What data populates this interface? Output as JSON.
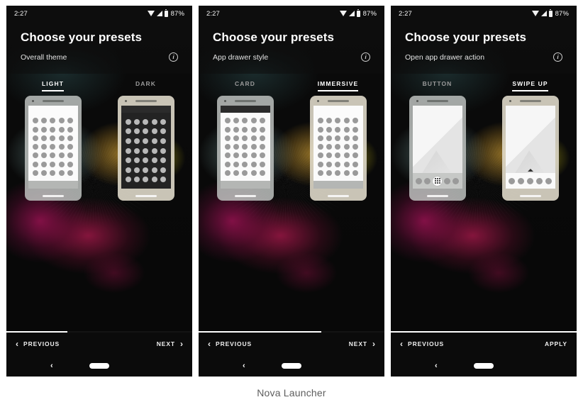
{
  "caption": "Nova Launcher",
  "status_bar": {
    "time": "2:27",
    "battery_percent": "87%",
    "icons": [
      "wifi-icon",
      "signal-icon",
      "battery-icon"
    ]
  },
  "common": {
    "title": "Choose your presets",
    "info_icon": "info-icon",
    "info_glyph": "i",
    "previous_label": "PREVIOUS",
    "prev_chevron": "‹",
    "next_chevron": "›"
  },
  "colors": {
    "panel_background": "#121212",
    "accent": "#ffffff",
    "selected_tab": "#ffffff",
    "unselected_tab": "#9a9a9a",
    "caption": "#5d5d5d"
  },
  "panels": [
    {
      "title": "Choose your presets",
      "subtitle": "Overall theme",
      "time": "2:27",
      "battery": "87%",
      "options": [
        {
          "label": "LIGHT",
          "selected": true
        },
        {
          "label": "DARK",
          "selected": false
        }
      ],
      "progress_percent": 33,
      "previous_label": "PREVIOUS",
      "next_label": "NEXT",
      "next_has_chevron": true
    },
    {
      "title": "Choose your presets",
      "subtitle": "App drawer style",
      "time": "2:27",
      "battery": "87%",
      "options": [
        {
          "label": "CARD",
          "selected": false
        },
        {
          "label": "IMMERSIVE",
          "selected": true
        }
      ],
      "progress_percent": 66,
      "previous_label": "PREVIOUS",
      "next_label": "NEXT",
      "next_has_chevron": true
    },
    {
      "title": "Choose your presets",
      "subtitle": "Open app drawer action",
      "time": "2:27",
      "battery": "87%",
      "options": [
        {
          "label": "BUTTON",
          "selected": false
        },
        {
          "label": "SWIPE UP",
          "selected": true
        }
      ],
      "progress_percent": 100,
      "previous_label": "PREVIOUS",
      "next_label": "APPLY",
      "next_has_chevron": false
    }
  ],
  "phone_previews": {
    "grid_columns": 5,
    "grid_rows": 7,
    "dock_icons": 5
  }
}
